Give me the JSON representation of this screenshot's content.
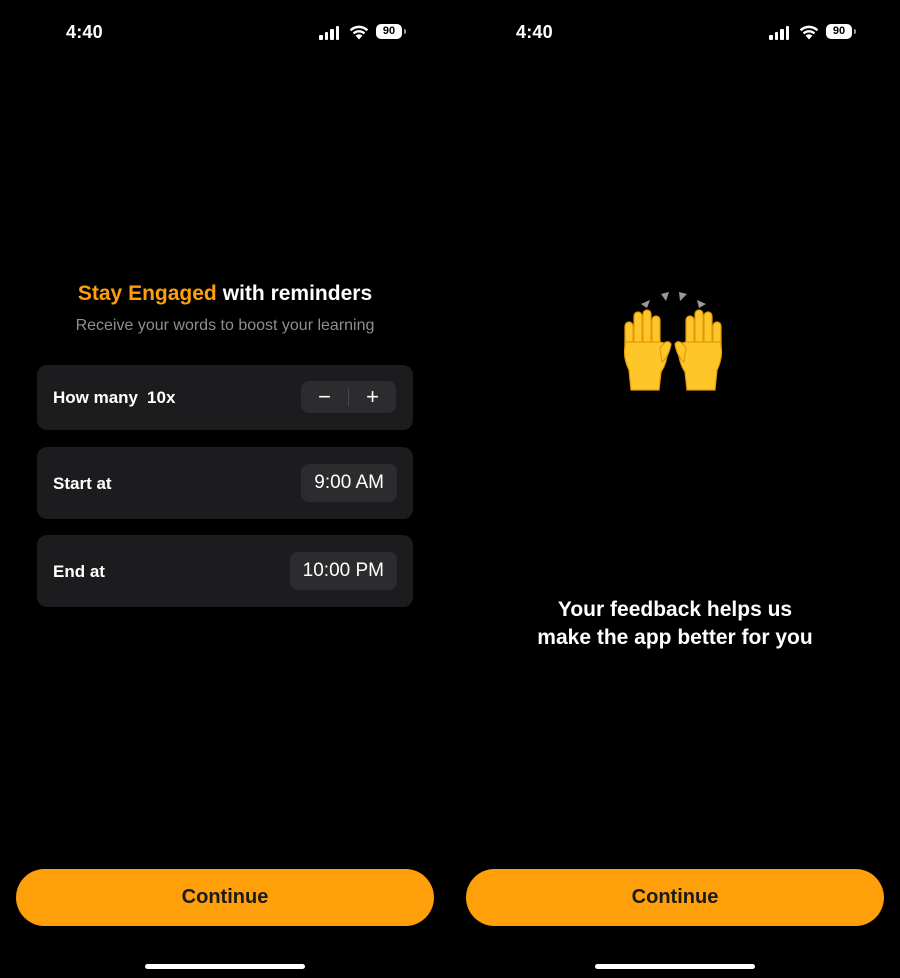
{
  "status_bar": {
    "time": "4:40",
    "battery": "90"
  },
  "left_screen": {
    "title_accent": "Stay Engaged",
    "title_rest": "with reminders",
    "subtitle": "Receive your words to boost your learning",
    "how_many": {
      "label": "How many",
      "value": "10x",
      "minus": "−",
      "plus": "+"
    },
    "start": {
      "label": "Start at",
      "value": "9:00 AM"
    },
    "end": {
      "label": "End at",
      "value": "10:00 PM"
    },
    "continue_label": "Continue"
  },
  "right_screen": {
    "emoji": "raising-hands-emoji",
    "feedback_line1": "Your feedback helps us",
    "feedback_line2": "make the app better for you",
    "continue_label": "Continue"
  },
  "colors": {
    "accent": "#FF9F0A",
    "row_bg": "#1c1c1e",
    "control_bg": "#2c2c2e",
    "subtitle": "#8e8e93"
  }
}
